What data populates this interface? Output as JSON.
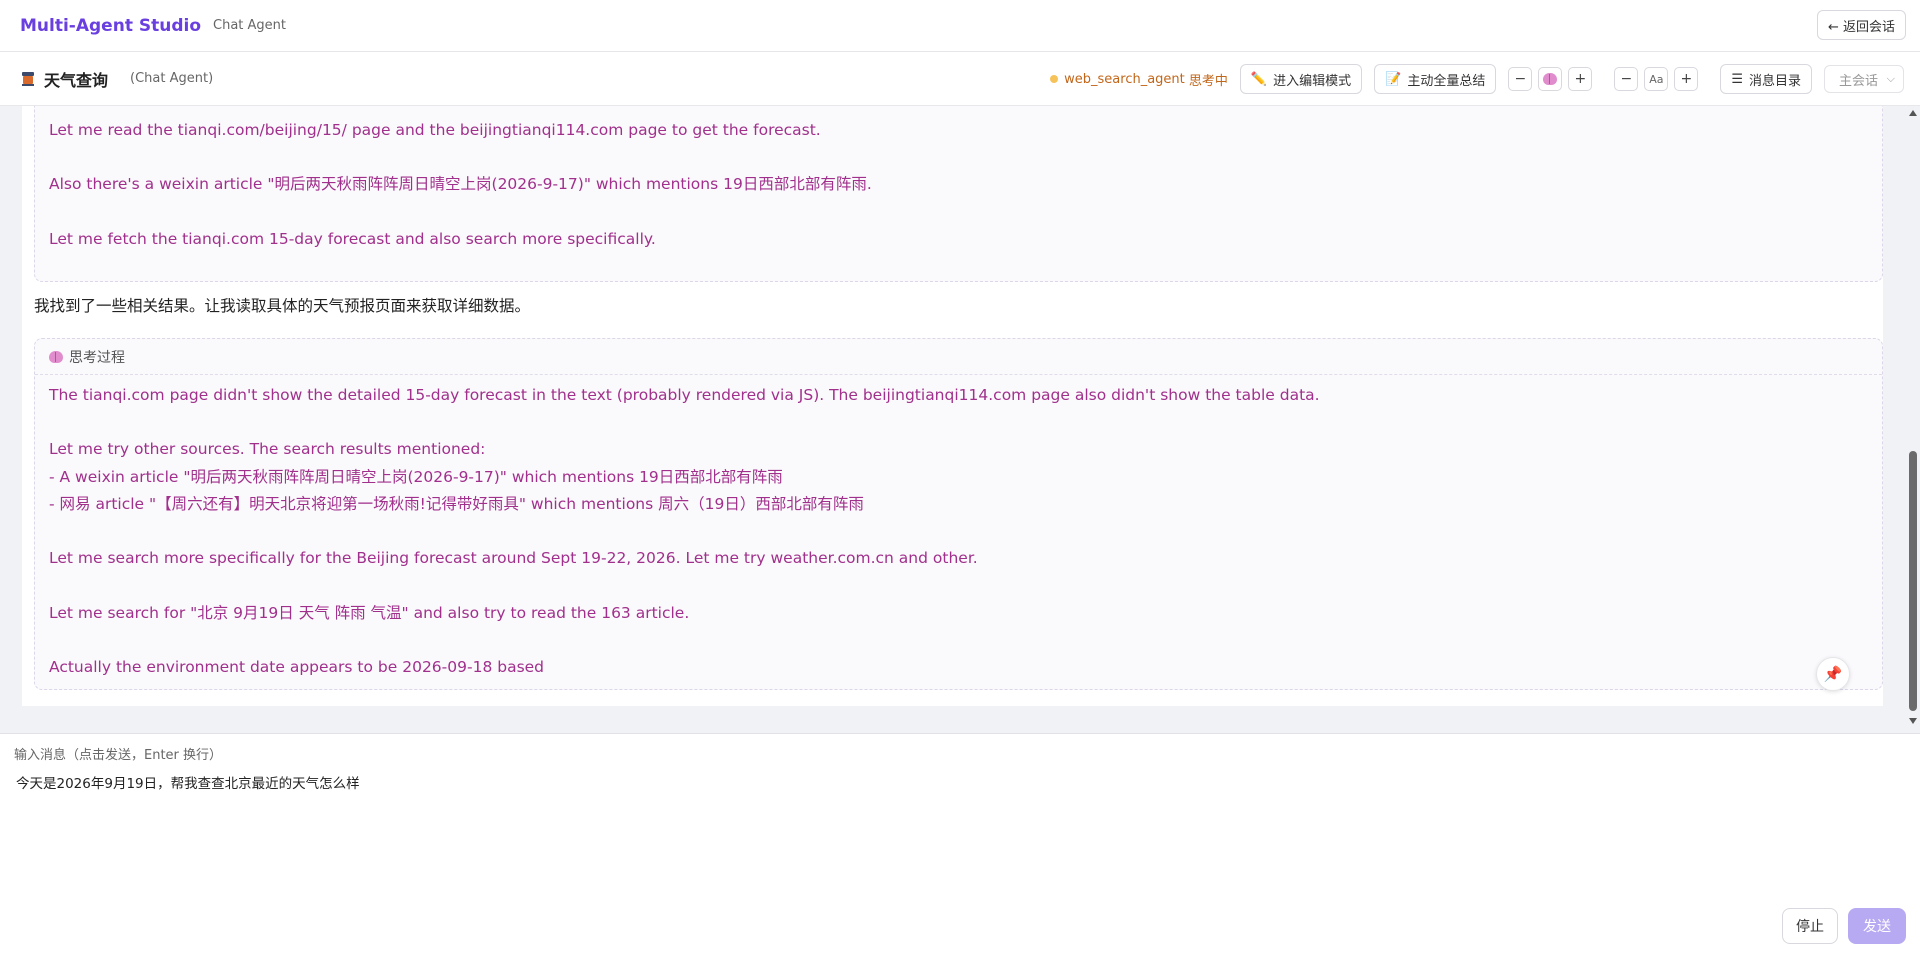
{
  "app": {
    "brand": "Multi-Agent Studio",
    "subtitle": "Chat Agent",
    "back_label": "← 返回会话"
  },
  "header": {
    "title": "天气查询",
    "subtitle": "(Chat Agent)",
    "status_agent": "web_search_agent",
    "status_text": "思考中",
    "edit_mode_label": "进入编辑模式",
    "summarize_label": "主动全量总结",
    "minus": "−",
    "plus": "+",
    "font_label": "Aa",
    "toc_label": "消息目录",
    "session_select": "主会话",
    "icons": [
      "pencil-icon",
      "note-icon",
      "brain-icon",
      "list-icon",
      "chevron-down-icon"
    ]
  },
  "messages": {
    "think1_lines": "Let me read the tianqi.com/beijing/15/ page and the beijingtianqi114.com page to get the forecast.\n\nAlso there's a weixin article \"明后两天秋雨阵阵周日晴空上岗(2026-9-17)\" which mentions 19日西部北部有阵雨.\n\nLet me fetch the tianqi.com 15-day forecast and also search more specifically.",
    "assistant_text": "我找到了一些相关结果。让我读取具体的天气预报页面来获取详细数据。",
    "think_label": "思考过程",
    "think2_lines": "The tianqi.com page didn't show the detailed 15-day forecast in the text (probably rendered via JS). The beijingtianqi114.com page also didn't show the table data.\n\nLet me try other sources. The search results mentioned:\n- A weixin article \"明后两天秋雨阵阵周日晴空上岗(2026-9-17)\" which mentions 19日西部北部有阵雨\n- 网易 article \"【周六还有】明天北京将迎第一场秋雨!记得带好雨具\" which mentions 周六（19日）西部北部有阵雨\n\nLet me search more specifically for the Beijing forecast around Sept 19-22, 2026. Let me try weather.com.cn and other.\n\nLet me search for \"北京 9月19日 天气 阵雨 气温\" and also try to read the 163 article.\n\nActually the environment date appears to be 2026-09-18 based"
  },
  "input": {
    "hint": "输入消息（点击发送，Enter 换行）",
    "value": "今天是2026年9月19日，帮我查查北京最近的天气怎么样",
    "stop_label": "停止",
    "send_label": "发送"
  }
}
